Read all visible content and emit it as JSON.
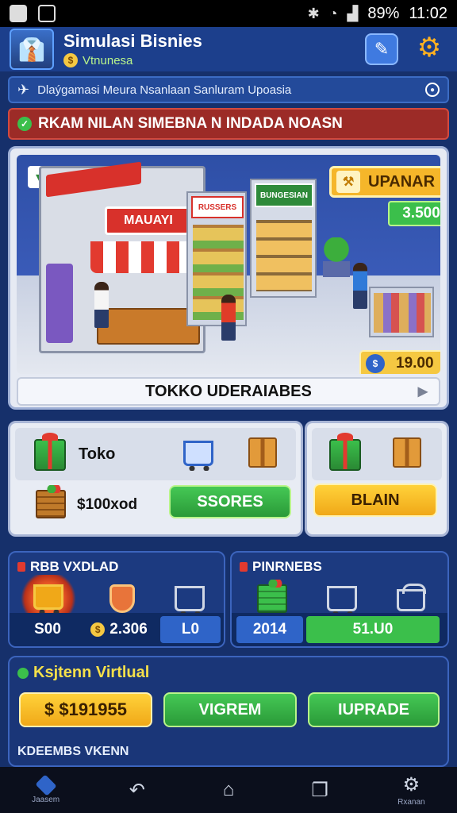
{
  "status_bar": {
    "battery": "89%",
    "time": "11:02"
  },
  "header": {
    "title": "Simulasi Bisnies",
    "subtitle": "Vtnunesa",
    "edit_icon": "pencil-icon",
    "settings_icon": "gear-icon"
  },
  "info_bar": {
    "text": "Dlaýgamasi Meura Nsanlaan Sanluram Upoasia"
  },
  "alert_bar": {
    "text": "RKAM NILAN SIMEBNA N INDADA NOASN"
  },
  "scene": {
    "store_sign": "MAUAYI",
    "mid_sign": "RUSSERS",
    "right_sign": "BUNGESIAN",
    "upgrade_badge": "UPANAR",
    "price_green": "3.500",
    "coin_value": "19.00",
    "footer_label": "TOKKO UDERAIABES"
  },
  "panel_a": {
    "row1_label": "Toko",
    "row2_value": "$100xod",
    "button_label": "SSORES"
  },
  "panel_b": {
    "button_label": "BLAIN"
  },
  "stats_left": {
    "title": "RBB VXDLAD",
    "stat1": "S00",
    "stat2": "2.306",
    "stat3": "L0"
  },
  "stats_right": {
    "title": "PINRNEBS",
    "stat1": "2014",
    "stat2": "51.U0"
  },
  "bottom_panel": {
    "title": "Ksjtenn Virtlual",
    "money_button": "$ $191955",
    "green_button_1": "VIGREM",
    "green_button_2": "IUPRADE",
    "footer": "KDEEMBS VKENN"
  },
  "nav": {
    "home_caption": "Jaasem",
    "settings_caption": "Rxanan"
  },
  "colors": {
    "background": "#16306b",
    "accent_green": "#3bbf4b",
    "accent_yellow": "#f5c842",
    "alert_red": "#9c2b27"
  }
}
